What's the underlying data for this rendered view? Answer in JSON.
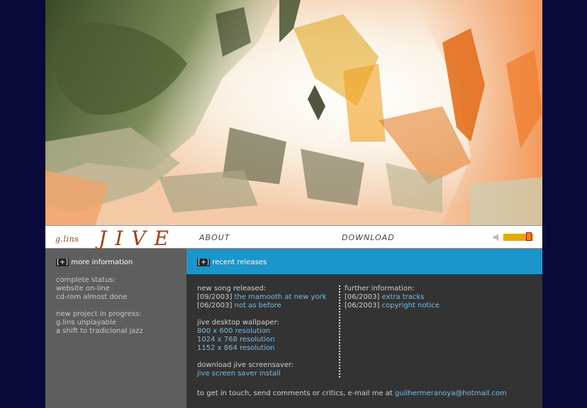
{
  "logo": {
    "small": "g.lins",
    "big": "JIVE"
  },
  "nav": {
    "about": "ABOUT",
    "download": "DOWNLOAD"
  },
  "volume": {
    "level": 0.8
  },
  "sidebar": {
    "title_bracket": "[+]",
    "title": "more information",
    "status_heading": "complete status:",
    "status_items": [
      "website on-line",
      "cd-rom almost done"
    ],
    "project_heading": "new project in progress:",
    "project_items": [
      "g.lins unplayable",
      "a shift to tradicional jazz"
    ]
  },
  "main": {
    "title_bracket": "[+]",
    "title": "recent releases",
    "new_song": {
      "heading": "new song released:",
      "items": [
        {
          "date": "[09/2003]",
          "link": "the mamooth at new york"
        },
        {
          "date": "[06/2003]",
          "link": "not as before"
        }
      ]
    },
    "wallpaper": {
      "heading": "jive desktop wallpaper:",
      "links": [
        "800 x 600 resolution",
        "1024 x 768 resolution",
        "1152 x 864 resolution"
      ]
    },
    "screensaver": {
      "heading": "download jive screensaver:",
      "link": "jive screen saver install"
    },
    "further": {
      "heading": "further information:",
      "items": [
        {
          "date": "[06/2003]",
          "link": "extra tracks"
        },
        {
          "date": "[06/2003]",
          "link": "copyright notice"
        }
      ]
    },
    "contact": {
      "text": "to get in touch, send comments or critics, e-mail me at",
      "email": "guilhermeranoya@hotmail.com"
    }
  },
  "colors": {
    "page_bg": "#0a0a3a",
    "accent_blue": "#1a96cc",
    "link": "#6cc0ec",
    "logo": "#b03a12"
  }
}
